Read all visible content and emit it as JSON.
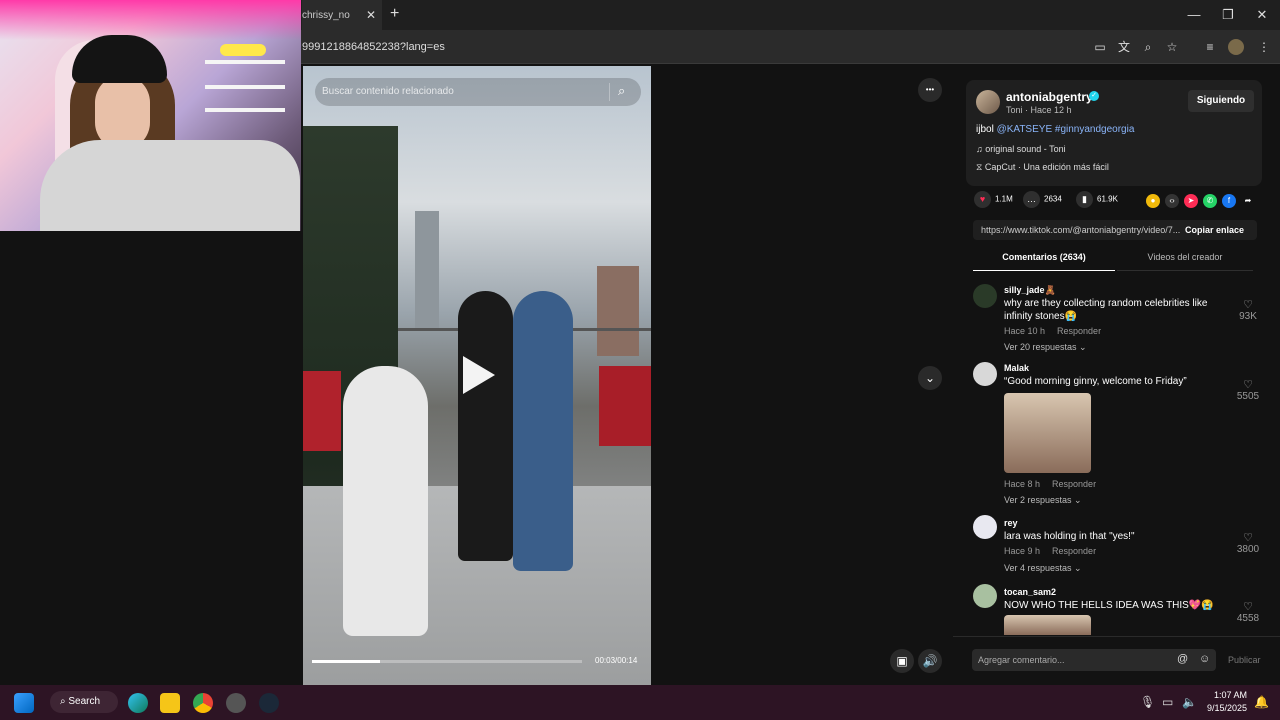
{
  "browser": {
    "tab_title": "chrissy_no",
    "new_tab": "+",
    "url": "9991218864852238?lang=es",
    "window_controls": {
      "minimize": "—",
      "maximize": "❐",
      "close": "✕"
    }
  },
  "video": {
    "search_placeholder": "Buscar contenido relacionado",
    "timecode": "00:03/00:14",
    "progress_fraction": 0.25,
    "more_label": "•••"
  },
  "author": {
    "username": "antoniabgentry",
    "subline": "Toni · Hace 12 h",
    "follow_label": "Siguiendo",
    "caption_prefix": "ijbol ",
    "caption_tags": "@KATSEYE #ginnyandgeorgia",
    "music": "original sound - Toni",
    "capcut": "CapCut · Una edición más fácil"
  },
  "actions": {
    "likes": "1.1M",
    "comments": "2634",
    "saves": "61.9K"
  },
  "link": {
    "url": "https://www.tiktok.com/@antoniabgentry/video/7...",
    "copy_label": "Copiar enlace"
  },
  "tabs": {
    "comments": "Comentarios (2634)",
    "creator_videos": "Videos del creador"
  },
  "comments": [
    {
      "user": "silly_jade🧸",
      "text": "why are they collecting random celebrities like infinity stones😭",
      "time": "Hace 10 h",
      "reply": "Responder",
      "replies": "Ver 20 respuestas ⌄",
      "likes": "93K"
    },
    {
      "user": "Malak",
      "text": "“Good morning ginny, welcome to Friday”",
      "time": "Hace 8 h",
      "reply": "Responder",
      "replies": "Ver 2 respuestas ⌄",
      "likes": "5505"
    },
    {
      "user": "rey",
      "text": "lara was holding in that \"yes!\"",
      "time": "Hace 9 h",
      "reply": "Responder",
      "replies": "Ver 4 respuestas ⌄",
      "likes": "3800"
    },
    {
      "user": "tocan_sam2",
      "text": "NOW WHO THE HELLS IDEA WAS THIS💖😭",
      "likes": "4558"
    }
  ],
  "comment_input": {
    "placeholder": "Agregar comentario...",
    "publish_label": "Publicar"
  },
  "taskbar": {
    "search_label": "Search",
    "time": "1:07 AM",
    "date": "9/15/2025"
  },
  "colors": {
    "accent_like": "#fe2c55",
    "verified": "#20d5ec",
    "hashtag": "#8ab4f8",
    "taskbar": "#2d1424"
  }
}
